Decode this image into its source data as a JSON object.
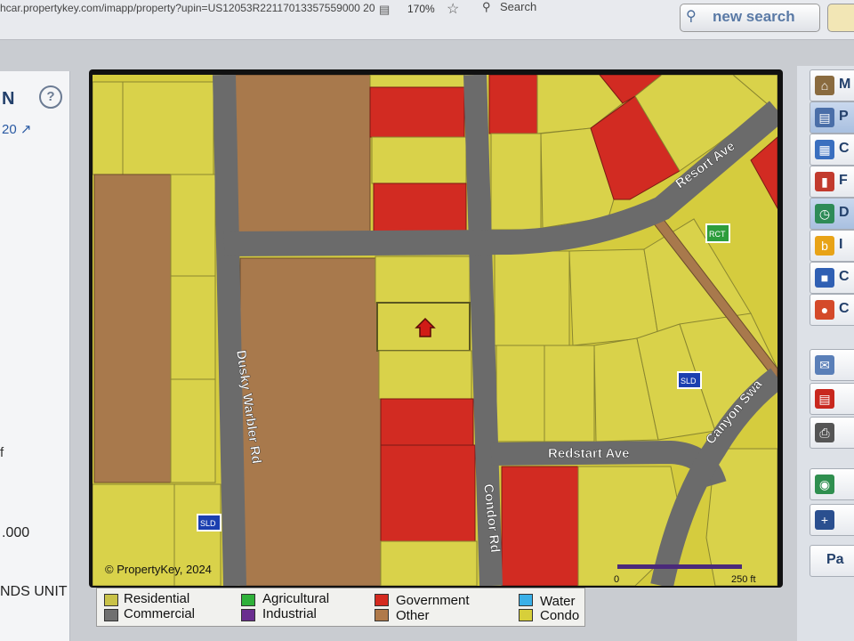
{
  "browser": {
    "url": "hcar.propertykey.com/imapp/property?upin=US12053R22117013357559000 20",
    "zoom": "170%",
    "search_label": "Search"
  },
  "app": {
    "new_search_label": "new search"
  },
  "left_panel": {
    "title": "N",
    "help": "?",
    "link_text": "20",
    "fragment": "f",
    "value": ".000",
    "unit": "NDS UNIT"
  },
  "map": {
    "copyright": "© PropertyKey, 2024",
    "streets": [
      "Resort Ave",
      "Dusky Warbler Rd",
      "Redstart Ave",
      "Condor Rd",
      "Canyon Swa"
    ],
    "badges": [
      "RCT",
      "SLD",
      "SLD"
    ],
    "scale_start": "0",
    "scale_end": "250 ft"
  },
  "legend": [
    {
      "label": "Residential",
      "color": "#c9c248"
    },
    {
      "label": "Commercial",
      "color": "#707070"
    },
    {
      "label": "Agricultural",
      "color": "#2fb13a"
    },
    {
      "label": "Industrial",
      "color": "#6a2d8f"
    },
    {
      "label": "Government",
      "color": "#d42a1f"
    },
    {
      "label": "Other",
      "color": "#b07a4a"
    },
    {
      "label": "Water",
      "color": "#3ab0e8"
    },
    {
      "label": "Condo",
      "color": "#d7cf3a"
    }
  ],
  "right_panel": {
    "buttons": [
      "M",
      "P",
      "C",
      "F",
      "D",
      "I",
      "C",
      "C"
    ]
  }
}
